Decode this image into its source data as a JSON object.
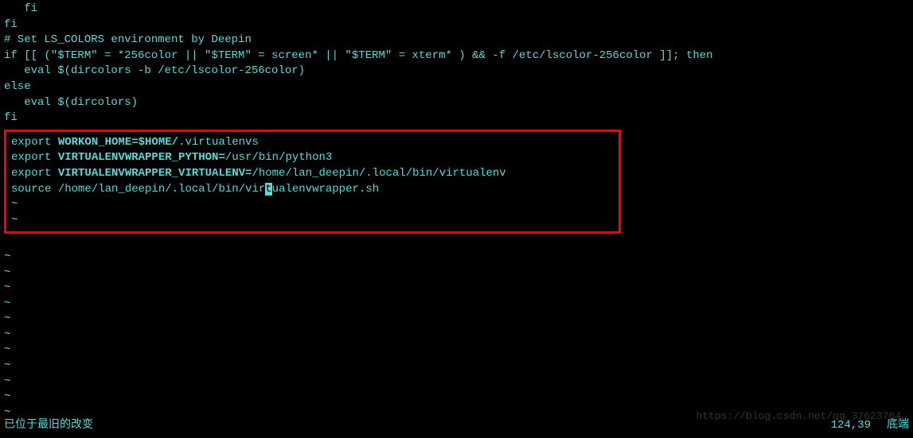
{
  "code": {
    "line1": "   fi",
    "line2": "fi",
    "line3": "# Set LS_COLORS environment by Deepin",
    "line4_prefix": "if [[ (",
    "line4_term1": "\"$TERM\"",
    "line4_mid1": " = *256color || ",
    "line4_term2": "\"$TERM\"",
    "line4_mid2": " = screen* || ",
    "line4_term3": "\"$TERM\"",
    "line4_suffix": " = xterm* ) && -f /etc/lscolor-256color ]]; then",
    "line5": "   eval $(dircolors -b /etc/lscolor-256color)",
    "line6": "else",
    "line7": "   eval $(dircolors)",
    "line8": "fi"
  },
  "boxed": {
    "exp1_cmd": "export ",
    "exp1_var": "WORKON_HOME=$HOME/",
    "exp1_path": ".virtualenvs",
    "exp2_cmd": "export ",
    "exp2_var": "VIRTUALENVWRAPPER_PYTHON=",
    "exp2_path": "/usr/bin/python3",
    "exp3_cmd": "export ",
    "exp3_var": "VIRTUALENVWRAPPER_VIRTUALENV=",
    "exp3_path1": "/home/lan_deepin/",
    "exp3_path2": ".local/bin/virtualenv",
    "exp4_cmd": "source ",
    "exp4_path1": "/home/lan_deepin/",
    "exp4_path2": ".local/bin/vir",
    "exp4_cursor": "t",
    "exp4_path3": "ualenvwrapper.sh"
  },
  "tilde": "~",
  "status": {
    "message": "已位于最旧的改变",
    "position": "124,39",
    "mode": "底端"
  },
  "watermark": "https://blog.csdn.net/qq_37623764"
}
